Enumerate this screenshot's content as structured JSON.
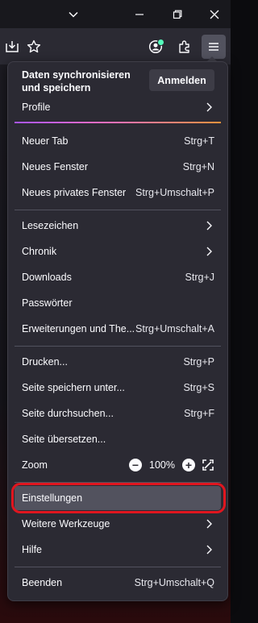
{
  "window": {
    "controls": [
      "chevron-down",
      "restore",
      "close"
    ]
  },
  "toolbar": {
    "icons": [
      "save-to-pocket-icon",
      "bookmark-star-icon",
      "account-icon",
      "extensions-icon",
      "menu-icon"
    ]
  },
  "menu": {
    "sync": {
      "title": "Daten synchronisieren und speichern",
      "signin_label": "Anmelden"
    },
    "profile_label": "Profile",
    "items": [
      {
        "label": "Neuer Tab",
        "shortcut": "Strg+T"
      },
      {
        "label": "Neues Fenster",
        "shortcut": "Strg+N"
      },
      {
        "label": "Neues privates Fenster",
        "shortcut": "Strg+Umschalt+P"
      },
      {
        "label": "Lesezeichen",
        "shortcut": ""
      },
      {
        "label": "Chronik",
        "shortcut": ""
      },
      {
        "label": "Downloads",
        "shortcut": "Strg+J"
      },
      {
        "label": "Passwörter",
        "shortcut": ""
      },
      {
        "label": "Erweiterungen und The...",
        "shortcut": "Strg+Umschalt+A"
      },
      {
        "label": "Drucken...",
        "shortcut": "Strg+P"
      },
      {
        "label": "Seite speichern unter...",
        "shortcut": "Strg+S"
      },
      {
        "label": "Seite durchsuchen...",
        "shortcut": "Strg+F"
      },
      {
        "label": "Seite übersetzen...",
        "shortcut": ""
      },
      {
        "label": "Zoom",
        "shortcut": ""
      },
      {
        "label": "Einstellungen",
        "shortcut": ""
      },
      {
        "label": "Weitere Werkzeuge",
        "shortcut": ""
      },
      {
        "label": "Hilfe",
        "shortcut": ""
      },
      {
        "label": "Beenden",
        "shortcut": "Strg+Umschalt+Q"
      }
    ],
    "zoom": {
      "minus": "−",
      "value": "100%",
      "plus": "+"
    }
  },
  "colors": {
    "panel": "#2b2a33",
    "highlight": "#52525e",
    "annotation_ring": "#e0161f"
  }
}
